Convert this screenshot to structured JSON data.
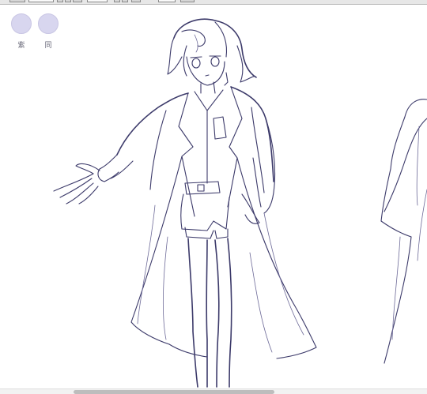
{
  "swatches": [
    {
      "label": "紫",
      "color": "#d8d6ef"
    },
    {
      "label": "同",
      "color": "#d8d6ef"
    }
  ],
  "canvas": {
    "background": "#ffffff",
    "line_color": "#3c3a6a"
  }
}
